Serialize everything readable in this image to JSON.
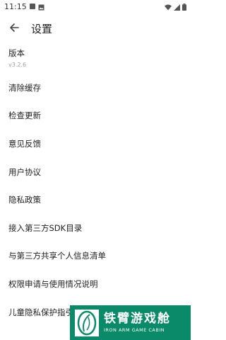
{
  "status_bar": {
    "time": "11:15",
    "icons": [
      "notification-square-icon",
      "image-icon",
      "wifi-icon",
      "signal-icon",
      "battery-icon"
    ]
  },
  "app_bar": {
    "back_icon": "arrow-left-icon",
    "title": "设置"
  },
  "settings": {
    "version_label": "版本",
    "version_value": "v3.2.6",
    "items": [
      "清除缓存",
      "检查更新",
      "意见反馈",
      "用户协议",
      "隐私政策",
      "接入第三方SDK目录",
      "与第三方共享个人信息清单",
      "权限申请与使用情况说明",
      "儿童隐私保护指引"
    ]
  },
  "watermark": {
    "name_cn": "铁臂游戏舱",
    "name_en": "IRON ARM GAME CABIN",
    "color": "#0a8a68"
  }
}
